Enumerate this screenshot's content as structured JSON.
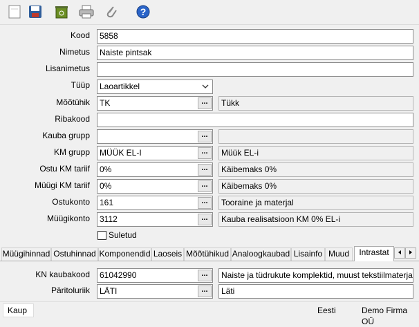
{
  "toolbar": {
    "buttons": [
      {
        "name": "new-icon"
      },
      {
        "name": "save-icon"
      },
      {
        "name": "recycle-icon"
      },
      {
        "name": "print-icon"
      },
      {
        "name": "attach-icon"
      },
      {
        "name": "help-icon",
        "label": "?"
      }
    ]
  },
  "form": {
    "kood": {
      "label": "Kood",
      "value": "5858"
    },
    "nimetus": {
      "label": "Nimetus",
      "value": "Naiste pintsak"
    },
    "lisanimetus": {
      "label": "Lisanimetus",
      "value": ""
    },
    "tyyp": {
      "label": "Tüüp",
      "value": "Laoartikkel"
    },
    "mootyhik": {
      "label": "Mõõtühik",
      "value": "TK",
      "desc": "Tükk"
    },
    "ribakood": {
      "label": "Ribakood",
      "value": ""
    },
    "kauba_grupp": {
      "label": "Kauba grupp",
      "value": "",
      "desc": ""
    },
    "km_grupp": {
      "label": "KM grupp",
      "value": "MÜÜK EL-I",
      "desc": "Müük EL-i"
    },
    "ostu_km": {
      "label": "Ostu KM tariif",
      "value": "0%",
      "desc": "Käibemaks 0%"
    },
    "myygi_km": {
      "label": "Müügi KM tariif",
      "value": "0%",
      "desc": "Käibemaks 0%"
    },
    "ostukonto": {
      "label": "Ostukonto",
      "value": "161",
      "desc": "Tooraine ja materjal"
    },
    "myygikonto": {
      "label": "Müügikonto",
      "value": "3112",
      "desc": "Kauba realisatsioon KM 0% EL-i"
    },
    "suletud": {
      "label": "Suletud",
      "checked": false
    }
  },
  "dots_label": "...",
  "tabs": [
    {
      "label": "Müügihinnad"
    },
    {
      "label": "Ostuhinnad"
    },
    {
      "label": "Komponendid"
    },
    {
      "label": "Laoseis"
    },
    {
      "label": "Mõõtühikud"
    },
    {
      "label": "Analoogkaubad"
    },
    {
      "label": "Lisainfo"
    },
    {
      "label": "Muud"
    },
    {
      "label": "Intrastat",
      "active": true
    }
  ],
  "intrastat": {
    "kn": {
      "label": "KN kaubakood",
      "value": "61042990",
      "desc": "Naiste ja tüdrukute komplektid, muust tekstiilmaterjalist, si"
    },
    "paritolu": {
      "label": "Päritoluriik",
      "value": "LÄTI",
      "desc": "Läti"
    }
  },
  "status": {
    "left": "Kaup",
    "language": "Eesti",
    "company": "Demo Firma OÜ"
  }
}
